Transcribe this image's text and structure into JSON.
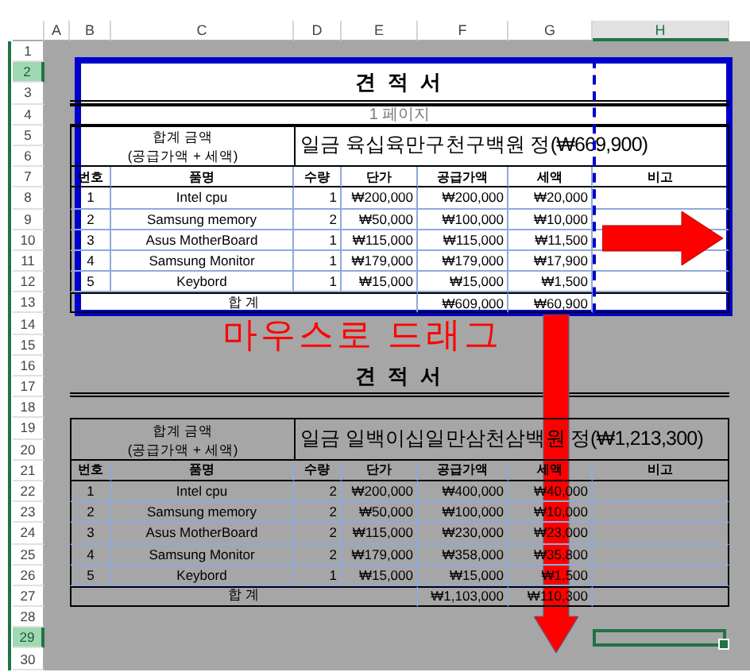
{
  "column_headers": [
    {
      "label": "A",
      "selected": false
    },
    {
      "label": "B",
      "selected": false
    },
    {
      "label": "C",
      "selected": false
    },
    {
      "label": "D",
      "selected": false
    },
    {
      "label": "E",
      "selected": false
    },
    {
      "label": "F",
      "selected": false
    },
    {
      "label": "G",
      "selected": false
    },
    {
      "label": "H",
      "selected": true
    }
  ],
  "row_headers": [
    {
      "label": "1",
      "selected": false
    },
    {
      "label": "2",
      "selected": true
    },
    {
      "label": "3",
      "selected": false
    },
    {
      "label": "4",
      "selected": false
    },
    {
      "label": "5",
      "selected": false
    },
    {
      "label": "6",
      "selected": false
    },
    {
      "label": "7",
      "selected": false
    },
    {
      "label": "8",
      "selected": false
    },
    {
      "label": "9",
      "selected": false
    },
    {
      "label": "10",
      "selected": false
    },
    {
      "label": "11",
      "selected": false
    },
    {
      "label": "12",
      "selected": false
    },
    {
      "label": "13",
      "selected": false
    },
    {
      "label": "14",
      "selected": false
    },
    {
      "label": "15",
      "selected": false
    },
    {
      "label": "16",
      "selected": false
    },
    {
      "label": "17",
      "selected": false
    },
    {
      "label": "18",
      "selected": false
    },
    {
      "label": "19",
      "selected": false
    },
    {
      "label": "20",
      "selected": false
    },
    {
      "label": "21",
      "selected": false
    },
    {
      "label": "22",
      "selected": false
    },
    {
      "label": "23",
      "selected": false
    },
    {
      "label": "24",
      "selected": false
    },
    {
      "label": "25",
      "selected": false
    },
    {
      "label": "26",
      "selected": false
    },
    {
      "label": "27",
      "selected": false
    },
    {
      "label": "28",
      "selected": false
    },
    {
      "label": "29",
      "selected": true
    },
    {
      "label": "30",
      "selected": false
    }
  ],
  "pages": [
    {
      "in_print_area": true,
      "page_label": "1 페이지",
      "title": "견 적 서",
      "amount_label": "합계 금액",
      "amount_sublabel": "(공급가액 + 세액)",
      "amount_text": "일금 육십육만구천구백원 정(₩669,900)",
      "columns": [
        "번호",
        "품명",
        "수량",
        "단가",
        "공급가액",
        "세액",
        "비고"
      ],
      "rows": [
        {
          "cells": [
            "1",
            "Intel cpu",
            "1",
            "₩200,000",
            "₩200,000",
            "₩20,000"
          ]
        },
        {
          "cells": [
            "2",
            "Samsung memory",
            "2",
            "₩50,000",
            "₩100,000",
            "₩10,000"
          ]
        },
        {
          "cells": [
            "3",
            "Asus MotherBoard",
            "1",
            "₩115,000",
            "₩115,000",
            "₩11,500"
          ]
        },
        {
          "cells": [
            "4",
            "Samsung Monitor",
            "1",
            "₩179,000",
            "₩179,000",
            "₩17,900"
          ]
        },
        {
          "cells": [
            "5",
            "Keybord",
            "1",
            "₩15,000",
            "₩15,000",
            "₩1,500"
          ]
        }
      ],
      "total_label": "합      계",
      "total_supply": "₩609,000",
      "total_tax": "₩60,900"
    },
    {
      "in_print_area": false,
      "title": "견 적 서",
      "amount_label": "합계 금액",
      "amount_sublabel": "(공급가액 + 세액)",
      "amount_text": "일금 일백이십일만삼천삼백원 정(₩1,213,300)",
      "columns": [
        "번호",
        "품명",
        "수량",
        "단가",
        "공급가액",
        "세액",
        "비고"
      ],
      "rows": [
        {
          "cells": [
            "1",
            "Intel cpu",
            "2",
            "₩200,000",
            "₩400,000",
            "₩40,000"
          ]
        },
        {
          "cells": [
            "2",
            "Samsung memory",
            "2",
            "₩50,000",
            "₩100,000",
            "₩10,000"
          ]
        },
        {
          "cells": [
            "3",
            "Asus MotherBoard",
            "2",
            "₩115,000",
            "₩230,000",
            "₩23,000"
          ]
        },
        {
          "cells": [
            "4",
            "Samsung Monitor",
            "2",
            "₩179,000",
            "₩358,000",
            "₩35,800"
          ]
        },
        {
          "cells": [
            "5",
            "Keybord",
            "1",
            "₩15,000",
            "₩15,000",
            "₩1,500"
          ]
        }
      ],
      "total_label": "합      계",
      "total_supply": "₩1,103,000",
      "total_tax": "₩110,300"
    }
  ],
  "annotation": {
    "text": "마우스로 드래그"
  }
}
